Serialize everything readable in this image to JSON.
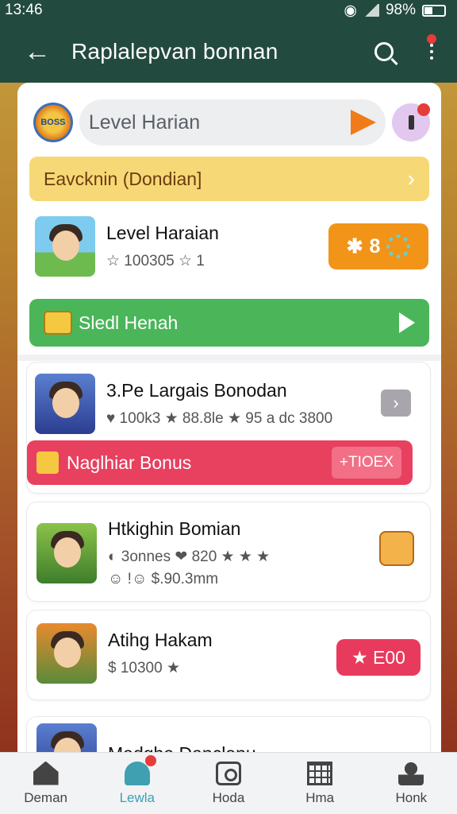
{
  "status": {
    "time": "13:46",
    "battery": "98%"
  },
  "appbar": {
    "title": "Raplalepvan bonnan"
  },
  "search": {
    "value": "Level Harian",
    "logo_text": "BOSS"
  },
  "banners": {
    "yellow": "Eavcknin (Dondian]",
    "green": "Sledl Henah"
  },
  "rows": [
    {
      "title": "Level Haraian",
      "meta": "☆ 100305 ☆ 1",
      "badge": "8"
    },
    {
      "title": "3.Pe Largais Bonodan",
      "meta": "♥ 100k3 ★ 88.8le ★ 95 a dc 3800"
    },
    {
      "title": "Htkighin Bomian",
      "meta": "◐ 3onnes ❤ 820 ★ ★ ★",
      "meta2": "☺ !☺ $.90.3mm"
    },
    {
      "title": "Atihg Hakam",
      "meta": "$ 10300 ★",
      "pill": "★ E00"
    },
    {
      "title": "Madgha Danclonu"
    }
  ],
  "pink_bar": {
    "label": "Naglhiar Bonus",
    "tag": "+TIOEX"
  },
  "bottom_nav": [
    {
      "label": "Deman",
      "active": false
    },
    {
      "label": "Lewla",
      "active": true
    },
    {
      "label": "Hoda",
      "active": false
    },
    {
      "label": "Hma",
      "active": false
    },
    {
      "label": "Honk",
      "active": false
    }
  ],
  "colors": {
    "appbar": "#234a3e",
    "accent": "#3ea0b0",
    "green": "#4bb55a",
    "pink": "#e8405f",
    "orange": "#f29418"
  }
}
